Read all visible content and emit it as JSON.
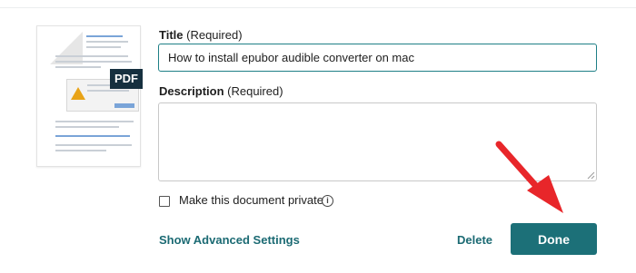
{
  "thumbnail": {
    "badge": "PDF"
  },
  "title_field": {
    "label": "Title",
    "hint": "(Required)",
    "value": "How to install epubor audible converter on mac"
  },
  "description_field": {
    "label": "Description",
    "hint": "(Required)",
    "value": ""
  },
  "privacy": {
    "label": "Make this document private",
    "checked": false,
    "info_glyph": "i"
  },
  "actions": {
    "advanced": "Show Advanced Settings",
    "delete": "Delete",
    "done": "Done"
  },
  "colors": {
    "accent": "#1c7078",
    "link": "#1b6a73",
    "annotation_arrow": "#e8262a",
    "pdf_badge": "#16303f"
  },
  "annotation": {
    "icon": "red-arrow-icon"
  }
}
